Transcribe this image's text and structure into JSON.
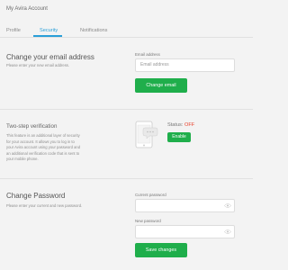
{
  "header": {
    "title": "My Avira Account"
  },
  "tabs": [
    {
      "label": "Profile"
    },
    {
      "label": "Security"
    },
    {
      "label": "Notifications"
    }
  ],
  "email": {
    "title": "Change your email address",
    "desc": "Please enter your new email address.",
    "field_label": "Email address",
    "placeholder": "Email address",
    "button": "Change email"
  },
  "twostep": {
    "title": "Two-step verification",
    "desc_lines": [
      "This feature is an additional layer of security",
      "for your account. It allows you to log in to",
      "your Avira account using your password and",
      "an additional verification code that is sent to",
      "your mobile phone."
    ],
    "status_label": "Status:",
    "status_value": "OFF",
    "button": "Enable"
  },
  "password": {
    "title": "Change Password",
    "desc": "Please enter your current and new password.",
    "current_label": "Current password",
    "new_label": "New password",
    "button": "Save changes"
  },
  "colors": {
    "accent": "#2a9fd8",
    "button": "#1fae4b",
    "status_off": "#e8412c"
  }
}
